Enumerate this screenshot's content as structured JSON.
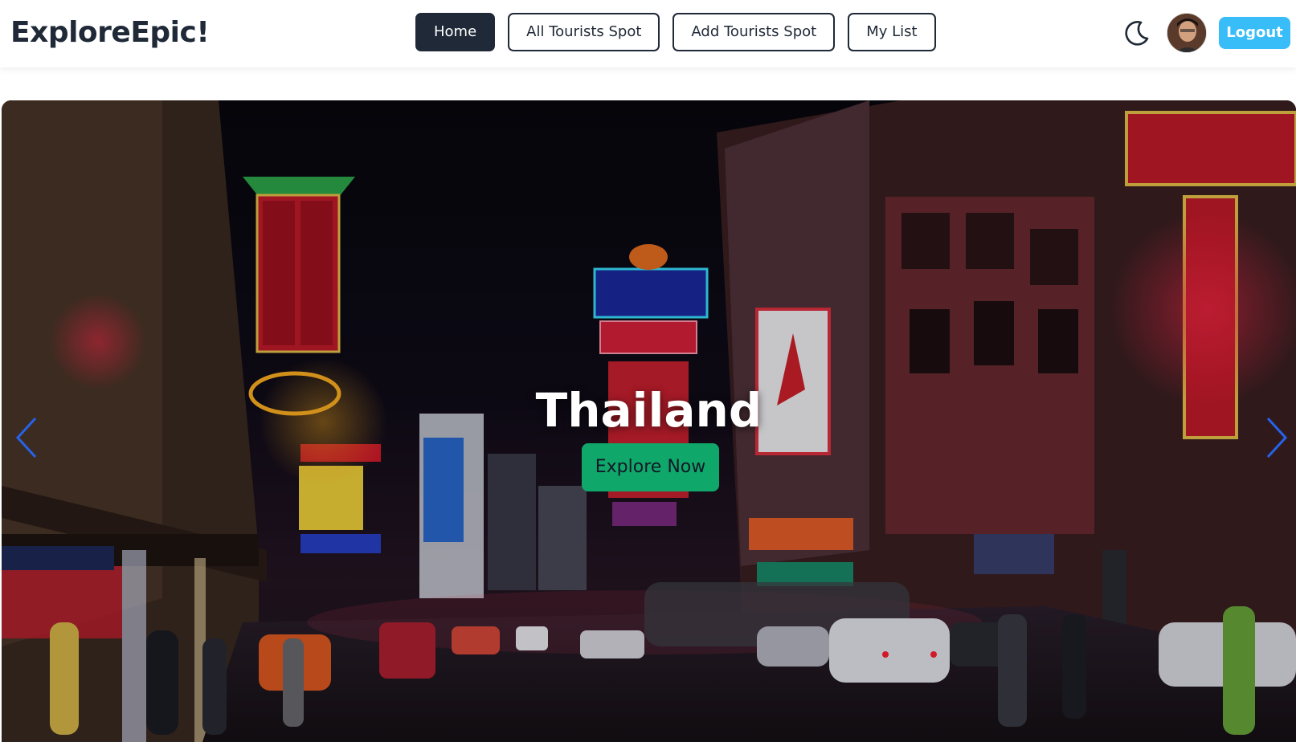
{
  "navbar": {
    "brand": "ExploreEpic!",
    "links": [
      {
        "label": "Home",
        "active": true
      },
      {
        "label": "All Tourists Spot",
        "active": false
      },
      {
        "label": "Add Tourists Spot",
        "active": false
      },
      {
        "label": "My List",
        "active": false
      }
    ],
    "theme_icon": "moon-icon",
    "logout_label": "Logout"
  },
  "hero": {
    "title": "Thailand",
    "cta_label": "Explore Now",
    "prev_icon": "chevron-left-icon",
    "next_icon": "chevron-right-icon"
  },
  "colors": {
    "dark": "#1f2937",
    "logout": "#38bdf8",
    "cta": "#10a86a",
    "arrows": "#2563eb"
  }
}
